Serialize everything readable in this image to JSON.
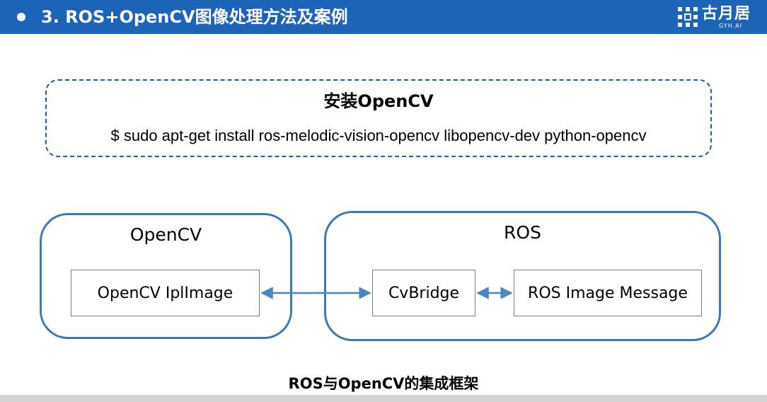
{
  "header": {
    "title": "3. ROS+OpenCV图像处理方法及案例",
    "logo_name": "古月居",
    "logo_sub": "GYH.AI",
    "logo_icon": "gyh-logo-icon",
    "bg_color": "#1c64b8"
  },
  "install": {
    "title": "安装OpenCV",
    "command": "$ sudo apt-get install ros-melodic-vision-opencv libopencv-dev python-opencv"
  },
  "diagram": {
    "groups": [
      {
        "title": "OpenCV"
      },
      {
        "title": "ROS"
      }
    ],
    "nodes": [
      {
        "label": "OpenCV IplImage"
      },
      {
        "label": "CvBridge"
      },
      {
        "label": "ROS Image Message"
      }
    ],
    "edges": [
      {
        "from": "OpenCV IplImage",
        "to": "CvBridge",
        "direction": "bidirectional"
      },
      {
        "from": "CvBridge",
        "to": "ROS Image Message",
        "direction": "bidirectional"
      }
    ],
    "border_color": "#3d78b8",
    "arrow_color": "#4a86c5",
    "caption": "ROS与OpenCV的集成框架"
  }
}
